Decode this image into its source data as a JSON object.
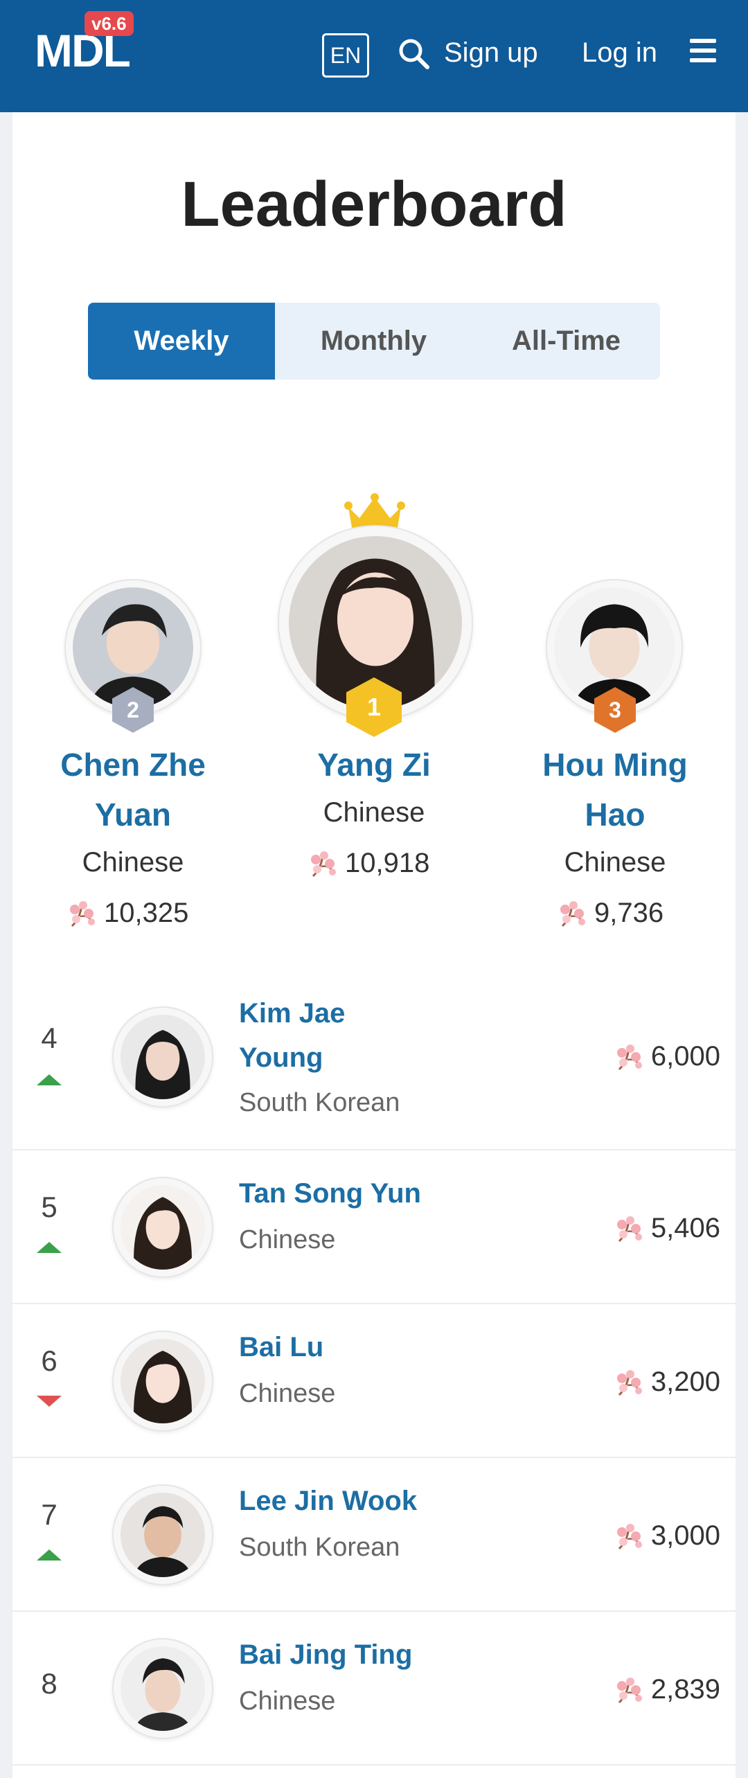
{
  "header": {
    "logo": "MDL",
    "version": "v6.6",
    "lang": "EN",
    "search_icon": "search-icon",
    "signup": "Sign up",
    "login": "Log in",
    "menu_icon": "hamburger-menu-icon",
    "bg_color": "#0f5a98"
  },
  "page": {
    "title": "Leaderboard",
    "tabs": [
      {
        "label": "Weekly",
        "active": true
      },
      {
        "label": "Monthly",
        "active": false
      },
      {
        "label": "All-Time",
        "active": false
      }
    ]
  },
  "podium": [
    {
      "rank": "2",
      "name_line1": "Chen Zhe",
      "name_line2": "Yuan",
      "nationality": "Chinese",
      "score": "10,325",
      "badge_color": "#a6aec0"
    },
    {
      "rank": "1",
      "name_line1": "Yang Zi",
      "nationality": "Chinese",
      "score": "10,918",
      "badge_color": "#f5c225"
    },
    {
      "rank": "3",
      "name_line1": "Hou Ming",
      "name_line2": "Hao",
      "nationality": "Chinese",
      "score": "9,736",
      "badge_color": "#e0742a"
    }
  ],
  "list": [
    {
      "rank": "4",
      "trend": "up",
      "name_line1": "Kim Jae",
      "name_line2": "Young",
      "nationality": "South Korean",
      "score": "6,000"
    },
    {
      "rank": "5",
      "trend": "up",
      "name_line1": "Tan Song Yun",
      "nationality": "Chinese",
      "score": "5,406"
    },
    {
      "rank": "6",
      "trend": "down",
      "name_line1": "Bai Lu",
      "nationality": "Chinese",
      "score": "3,200"
    },
    {
      "rank": "7",
      "trend": "up",
      "name_line1": "Lee Jin Wook",
      "nationality": "South Korean",
      "score": "3,000"
    },
    {
      "rank": "8",
      "trend": "none",
      "name_line1": "Bai Jing Ting",
      "nationality": "Chinese",
      "score": "2,839"
    }
  ],
  "colors": {
    "link_blue": "#1c6ea4",
    "tab_active": "#1a6fb3",
    "trend_up": "#3aa14a",
    "trend_down": "#e05050"
  }
}
